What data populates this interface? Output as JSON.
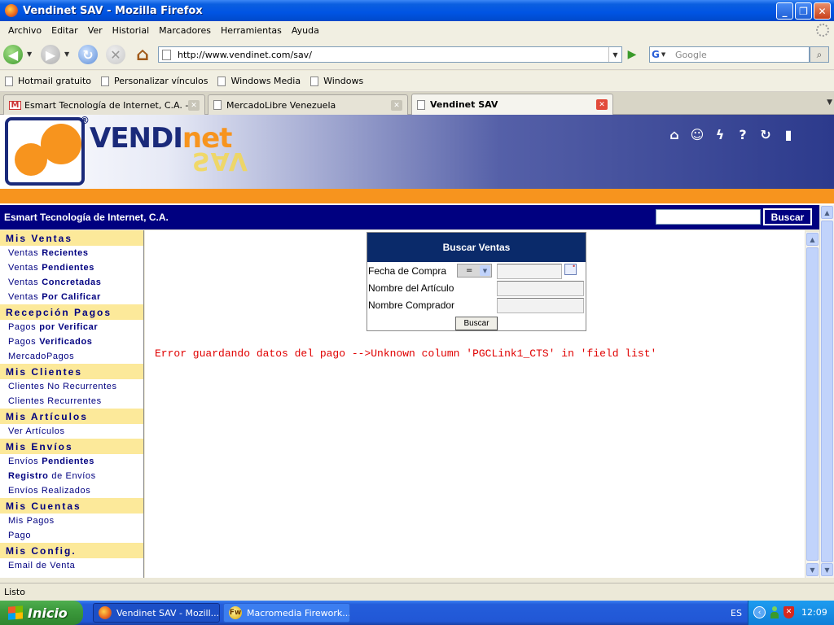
{
  "window": {
    "title": "Vendinet SAV - Mozilla Firefox",
    "buttons": [
      "_",
      "❐",
      "✕"
    ]
  },
  "menu": [
    "Archivo",
    "Editar",
    "Ver",
    "Historial",
    "Marcadores",
    "Herramientas",
    "Ayuda"
  ],
  "nav": {
    "url": "http://www.vendinet.com/sav/",
    "search_engine_glyph": "G",
    "search_placeholder": "Google"
  },
  "bookmarks": [
    "Hotmail gratuito",
    "Personalizar vínculos",
    "Windows Media",
    "Windows"
  ],
  "tabs": [
    {
      "label": "Esmart Tecnología de Internet, C.A. - ...",
      "icon": "gmail-icon",
      "active": false
    },
    {
      "label": "MercadoLibre Venezuela",
      "icon": "page-icon",
      "active": false
    },
    {
      "label": "Vendinet SAV",
      "icon": "page-icon",
      "active": true
    }
  ],
  "site": {
    "logo_main": "VENDI",
    "logo_accent": "net",
    "logo_registered": "®",
    "logo_sub": "SAV",
    "header_icons": [
      "home-icon",
      "user-icon",
      "lightning-icon",
      "help-icon",
      "refresh-icon",
      "exit-door-icon"
    ],
    "company": "Esmart Tecnología de Internet, C.A.",
    "search_button": "Buscar"
  },
  "sidebar": [
    {
      "title": "Mis Ventas",
      "items": [
        {
          "pre": "Ventas",
          "bold": "Recientes"
        },
        {
          "pre": "Ventas",
          "bold": "Pendientes"
        },
        {
          "pre": "Ventas",
          "bold": "Concretadas"
        },
        {
          "pre": "Ventas",
          "bold": "Por Calificar"
        }
      ]
    },
    {
      "title": "Recepción Pagos",
      "items": [
        {
          "pre": "Pagos",
          "bold": "por Verificar"
        },
        {
          "pre": "Pagos",
          "bold": "Verificados"
        },
        {
          "pre": "MercadoPagos",
          "bold": ""
        }
      ]
    },
    {
      "title": "Mis Clientes",
      "items": [
        {
          "pre": "Clientes No Recurrentes",
          "bold": ""
        },
        {
          "pre": "Clientes Recurrentes",
          "bold": ""
        }
      ]
    },
    {
      "title": "Mis Artículos",
      "items": [
        {
          "pre": "Ver Artículos",
          "bold": ""
        }
      ]
    },
    {
      "title": "Mis Envíos",
      "items": [
        {
          "pre": "Envíos",
          "bold": "Pendientes"
        },
        {
          "pre": "",
          "bold": "Registro",
          "post": "de Envíos"
        },
        {
          "pre": "Envíos Realizados",
          "bold": ""
        }
      ]
    },
    {
      "title": "Mis Cuentas",
      "items": [
        {
          "pre": "Mis Pagos",
          "bold": ""
        },
        {
          "pre": "Pago",
          "bold": ""
        }
      ]
    },
    {
      "title": "Mis Config.",
      "items": [
        {
          "pre": "Email de Venta",
          "bold": ""
        }
      ]
    }
  ],
  "search_panel": {
    "title": "Buscar Ventas",
    "fields": [
      "Fecha de Compra",
      "Nombre del Artículo",
      "Nombre Comprador"
    ],
    "operator": "=",
    "button": "Buscar"
  },
  "error": "Error guardando datos del pago -->Unknown column 'PGCLink1_CTS' in 'field list'",
  "status": "Listo",
  "taskbar": {
    "start": "Inicio",
    "tasks": [
      "Vendinet SAV - Mozill...",
      "Macromedia Firework..."
    ],
    "lang": "ES",
    "clock": "12:09"
  },
  "colors": {
    "header_navy": "#000080",
    "accent_orange": "#f7941e",
    "sidebar_head_bg": "#fce99a",
    "error_red": "#e00000",
    "panel_head": "#0a2a6a"
  }
}
